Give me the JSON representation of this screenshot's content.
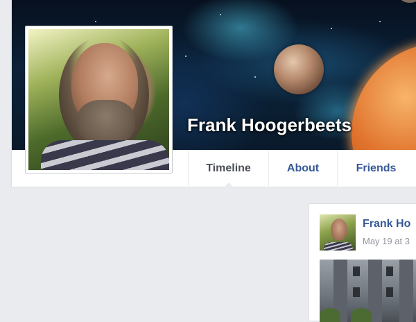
{
  "profile": {
    "name": "Frank Hoogerbeets"
  },
  "nav": {
    "tabs": [
      {
        "label": "Timeline",
        "active": true
      },
      {
        "label": "About",
        "active": false
      },
      {
        "label": "Friends",
        "active": false
      }
    ]
  },
  "post": {
    "author": "Frank Ho",
    "timestamp": "May 19 at 3"
  },
  "colors": {
    "link": "#365899",
    "background": "#e9ebee",
    "active_tab": "#4b4f56",
    "timestamp": "#90949c"
  }
}
